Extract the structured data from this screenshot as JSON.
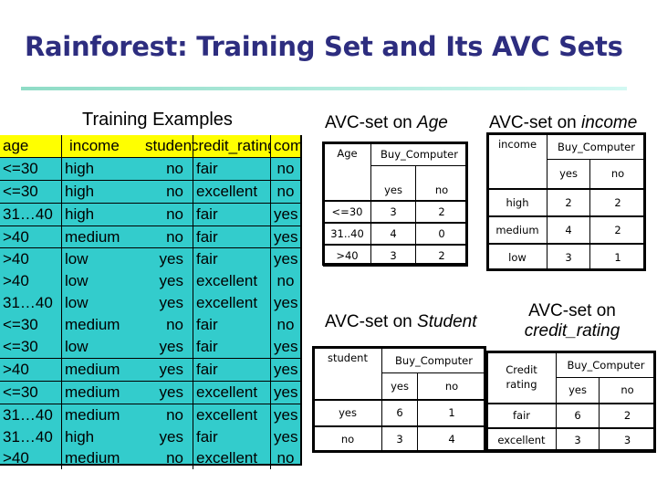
{
  "slide": {
    "title": "Rainforest:  Training Set and Its AVC Sets"
  },
  "training": {
    "heading": "Training Examples",
    "columns": [
      "age",
      "income",
      "student",
      "credit_rating",
      "comp"
    ],
    "rows": [
      [
        "<=30",
        "high",
        "no",
        "fair",
        "no"
      ],
      [
        "<=30",
        "high",
        "no",
        "excellent",
        "no"
      ],
      [
        "31…40",
        "high",
        "no",
        "fair",
        "yes"
      ],
      [
        ">40",
        "medium",
        "no",
        "fair",
        "yes"
      ],
      [
        ">40",
        "low",
        "yes",
        "fair",
        "yes"
      ],
      [
        ">40",
        "low",
        "yes",
        "excellent",
        "no"
      ],
      [
        "31…40",
        "low",
        "yes",
        "excellent",
        "yes"
      ],
      [
        "<=30",
        "medium",
        "no",
        "fair",
        "no"
      ],
      [
        "<=30",
        "low",
        "yes",
        "fair",
        "yes"
      ],
      [
        ">40",
        "medium",
        "yes",
        "fair",
        "yes"
      ],
      [
        "<=30",
        "medium",
        "yes",
        "excellent",
        "yes"
      ],
      [
        "31…40",
        "medium",
        "no",
        "excellent",
        "yes"
      ],
      [
        "31…40",
        "high",
        "yes",
        "fair",
        "yes"
      ],
      [
        ">40",
        "medium",
        "no",
        "excellent",
        "no"
      ]
    ],
    "colors": {
      "header_bg": "#ffff00",
      "body_bg": "#33cccc"
    }
  },
  "avc_age": {
    "heading_prefix": "AVC-set on ",
    "heading_attr": "Age",
    "attr_label": "Age",
    "class_label": "Buy_Computer",
    "yes_label": "yes",
    "no_label": "no",
    "rows": [
      {
        "value": "<=30",
        "yes": "3",
        "no": "2"
      },
      {
        "value": "31..40",
        "yes": "4",
        "no": "0"
      },
      {
        "value": ">40",
        "yes": "3",
        "no": "2"
      }
    ]
  },
  "avc_income": {
    "heading_prefix": "AVC-set on ",
    "heading_attr": "income",
    "attr_label": "income",
    "class_label": "Buy_Computer",
    "yes_label": "yes",
    "no_label": "no",
    "rows": [
      {
        "value": "high",
        "yes": "2",
        "no": "2"
      },
      {
        "value": "medium",
        "yes": "4",
        "no": "2"
      },
      {
        "value": "low",
        "yes": "3",
        "no": "1"
      }
    ]
  },
  "avc_student": {
    "heading_prefix": "AVC-set on ",
    "heading_attr": "Student",
    "attr_label": "student",
    "class_label": "Buy_Computer",
    "yes_label": "yes",
    "no_label": "no",
    "rows": [
      {
        "value": "yes",
        "yes": "6",
        "no": "1"
      },
      {
        "value": "no",
        "yes": "3",
        "no": "4"
      }
    ]
  },
  "avc_credit": {
    "heading_line1": "AVC-set on",
    "heading_attr": "credit_rating",
    "attr_label": "Credit rating",
    "class_label": "Buy_Computer",
    "yes_label": "yes",
    "no_label": "no",
    "rows": [
      {
        "value": "fair",
        "yes": "6",
        "no": "2"
      },
      {
        "value": "excellent",
        "yes": "3",
        "no": "3"
      }
    ]
  }
}
